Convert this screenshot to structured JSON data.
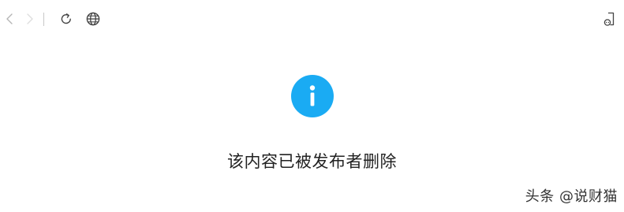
{
  "toolbar": {
    "icons": [
      "back-icon",
      "forward-icon",
      "reload-icon",
      "globe-icon",
      "share-icon"
    ]
  },
  "notice": {
    "icon": "info-icon",
    "icon_color": "#1aabf3",
    "message": "该内容已被发布者删除"
  },
  "watermark": {
    "text": "头条 @说财猫"
  }
}
